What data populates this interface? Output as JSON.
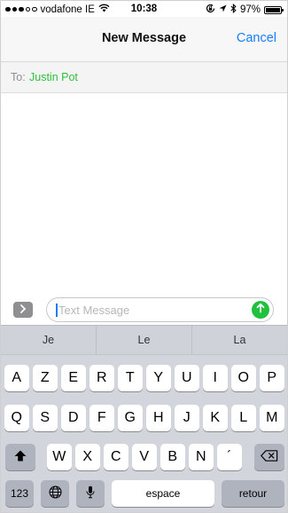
{
  "status_bar": {
    "carrier": "vodafone IE",
    "time": "10:38",
    "battery_percent": "97%",
    "battery_level": 0.97,
    "signal_dots": [
      true,
      true,
      true,
      false,
      false
    ],
    "icons": [
      "wifi-icon",
      "lock-rotation-icon",
      "location-icon",
      "bluetooth-icon",
      "battery-icon"
    ]
  },
  "nav": {
    "title": "New Message",
    "cancel_label": "Cancel"
  },
  "to_field": {
    "label": "To:",
    "recipient": "Justin Pot"
  },
  "compose": {
    "placeholder": "Text Message",
    "value": "",
    "expand_icon": "chevron-right-icon",
    "send_icon": "arrow-up-icon"
  },
  "keyboard": {
    "suggestions": [
      "Je",
      "Le",
      "La"
    ],
    "row1": [
      "A",
      "Z",
      "E",
      "R",
      "T",
      "Y",
      "U",
      "I",
      "O",
      "P"
    ],
    "row2": [
      "Q",
      "S",
      "D",
      "F",
      "G",
      "H",
      "J",
      "K",
      "L",
      "M"
    ],
    "row3": [
      "W",
      "X",
      "C",
      "V",
      "B",
      "N",
      "´"
    ],
    "numbers_label": "123",
    "space_label": "espace",
    "return_label": "retour",
    "shift_icon": "shift-icon",
    "delete_icon": "delete-icon",
    "globe_icon": "globe-icon",
    "mic_icon": "microphone-icon"
  },
  "colors": {
    "accent_blue": "#1a7cf5",
    "recipient_green": "#2fbf3c",
    "send_green": "#1fc13d",
    "keyboard_bg": "#d2d5db",
    "special_key": "#aeb3be"
  }
}
